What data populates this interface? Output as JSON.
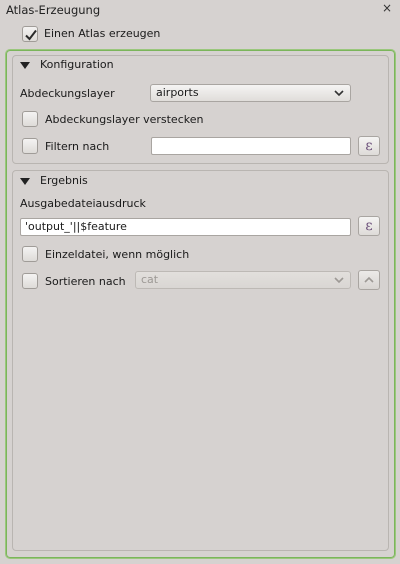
{
  "window": {
    "title": "Atlas-Erzeugung",
    "close_glyph": "×"
  },
  "atlas_toggle": {
    "label": "Einen Atlas erzeugen",
    "checked": true
  },
  "konfiguration": {
    "header": "Konfiguration",
    "coverage_label": "Abdeckungslayer",
    "coverage_value": "airports",
    "hide_label": "Abdeckungslayer verstecken",
    "hide_checked": false,
    "filter_label": "Filtern nach",
    "filter_checked": false,
    "filter_value": "",
    "expression_glyph": "ε"
  },
  "ergebnis": {
    "header": "Ergebnis",
    "output_label": "Ausgabedateiausdruck",
    "output_value": "'output_'||$feature",
    "expression_glyph": "ε",
    "single_file_label": "Einzeldatei, wenn möglich",
    "single_file_checked": false,
    "sort_label": "Sortieren nach",
    "sort_checked": false,
    "sort_value": "cat"
  },
  "colors": {
    "accent_frame": "#7bb55b",
    "panel_bg": "#d6d2d0"
  },
  "icons": [
    "checkmark-icon",
    "triangle-down-icon",
    "chevron-down-icon",
    "epsilon-icon",
    "chevron-up-icon",
    "close-icon"
  ]
}
